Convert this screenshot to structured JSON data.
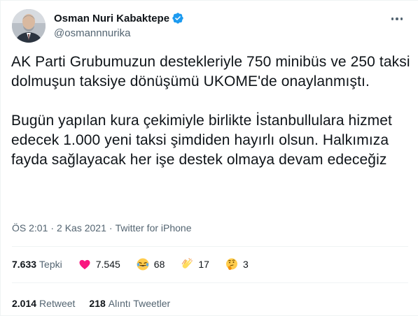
{
  "author": {
    "display_name": "Osman Nuri Kabaktepe",
    "handle": "@osmannnurika",
    "verified": true
  },
  "tweet": {
    "paragraphs": [
      "AK Parti Grubumuzun destekleriyle 750 minibüs ve 250 taksi dolmuşun taksiye dönüşümü UKOME'de onaylanmıştı.",
      "Bugün yapılan kura çekimiyle birlikte İstanbullulara hizmet edecek 1.000 yeni taksi şimdiden hayırlı olsun. Halkımıza fayda sağlayacak her işe destek olmaya devam edeceğiz"
    ],
    "time": "ÖS 2:01",
    "date": "2 Kas 2021",
    "source": "Twitter for iPhone",
    "separator": "·"
  },
  "reactions": {
    "total": "7.633",
    "total_label": "Tepki",
    "items": [
      {
        "icon": "heart-icon",
        "count": "7.545"
      },
      {
        "icon": "laughing-emoji-icon",
        "count": "68"
      },
      {
        "icon": "clapping-hands-icon",
        "count": "17"
      },
      {
        "icon": "thinking-emoji-icon",
        "count": "3"
      }
    ]
  },
  "stats": {
    "retweets": "2.014",
    "retweets_label": "Retweet",
    "quotes": "218",
    "quotes_label": "Alıntı Tweetler"
  },
  "colors": {
    "text": "#0f1419",
    "secondary": "#536471",
    "verified": "#1d9bf0",
    "heart": "#f91880",
    "divider": "#eff3f4"
  }
}
